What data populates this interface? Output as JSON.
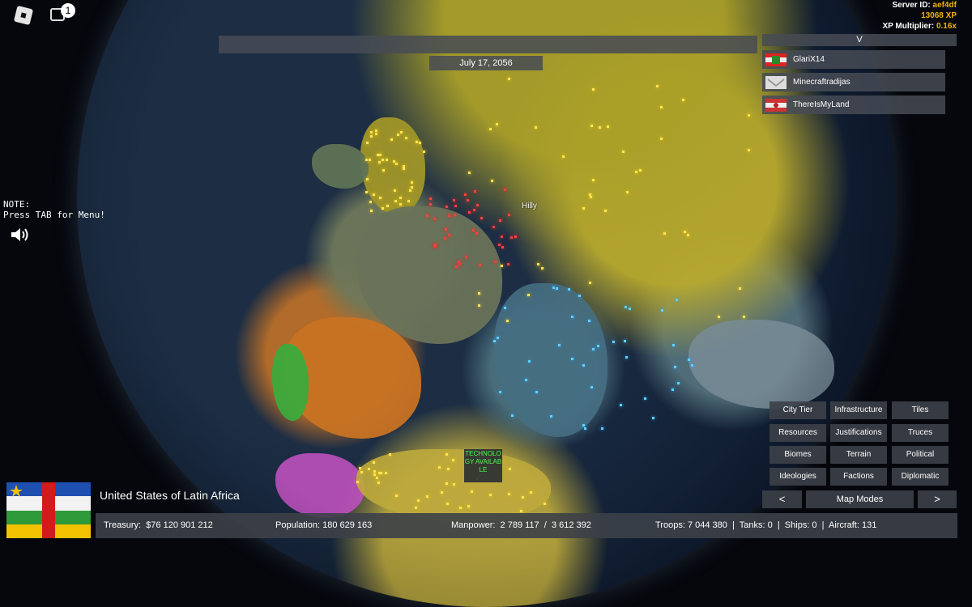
{
  "server": {
    "id_label": "Server ID:",
    "id_value": "aef4df",
    "xp": "13068 XP",
    "multiplier_label": "XP Multiplier:",
    "multiplier_value": "0.16x"
  },
  "notifications": {
    "count": "1"
  },
  "date": "July 17, 2056",
  "players": {
    "toggle": "V",
    "list": [
      {
        "name": "GlariX14",
        "flag": "flag-icon"
      },
      {
        "name": "Minecraftradijas",
        "flag": "flag-icon"
      },
      {
        "name": "ThereIsMyLand",
        "flag": "flag-icon"
      }
    ]
  },
  "note": {
    "line1": "NOTE:",
    "line2": "Press TAB for Menu!"
  },
  "map": {
    "city_label": "Hilly",
    "tech_notice": "TECHNOLOGY AVAILABLE"
  },
  "map_modes": {
    "buttons": [
      "City Tier",
      "Infrastructure",
      "Tiles",
      "Resources",
      "Justifications",
      "Truces",
      "Biomes",
      "Terrain",
      "Political",
      "Ideologies",
      "Factions",
      "Diplomatic"
    ],
    "prev": "<",
    "label": "Map Modes",
    "next": ">"
  },
  "country": {
    "name": "United States of Latin Africa",
    "treasury_label": "Treasury:",
    "treasury": "$76 120 901 212",
    "population_label": "Population:",
    "population": "180 629 163",
    "manpower_label": "Manpower:",
    "manpower": "2 789 117  /  3 612 392",
    "military": "Troops: 7 044 380  |  Tanks: 0  |  Ships: 0  |  Aircraft: 131"
  },
  "colors": {
    "accent_xp": "#f0b400",
    "tech_green": "#49ff49",
    "panel": "#464b55"
  }
}
